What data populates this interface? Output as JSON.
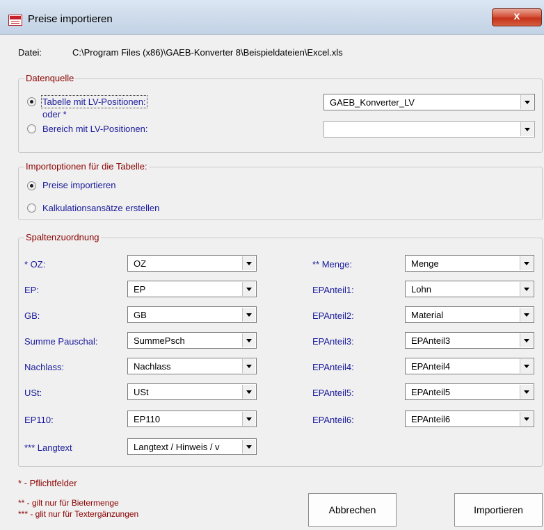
{
  "window": {
    "title": "Preise importieren",
    "close_glyph": "x"
  },
  "file": {
    "label": "Datei:",
    "path": "C:\\Program Files (x86)\\GAEB-Konverter 8\\Beispieldateien\\Excel.xls"
  },
  "datenquelle": {
    "title": "Datenquelle",
    "option_table": "Tabelle mit LV-Positionen:",
    "oder": "oder *",
    "option_range": "Bereich mit LV-Positionen:",
    "table_value": "GAEB_Konverter_LV",
    "range_value": ""
  },
  "importoptionen": {
    "title": "Importoptionen für die Tabelle:",
    "option_prices": "Preise importieren",
    "option_calc": "Kalkulationsansätze erstellen"
  },
  "spalten": {
    "title": "Spaltenzuordnung",
    "left": [
      {
        "label": "* OZ:",
        "value": "OZ"
      },
      {
        "label": "EP:",
        "value": "EP"
      },
      {
        "label": "GB:",
        "value": "GB"
      },
      {
        "label": "Summe Pauschal:",
        "value": "SummePsch"
      },
      {
        "label": "Nachlass:",
        "value": "Nachlass"
      },
      {
        "label": "USt:",
        "value": "USt"
      },
      {
        "label": "EP110:",
        "value": "EP110"
      },
      {
        "label": "*** Langtext",
        "value": "Langtext / Hinweis / v"
      }
    ],
    "right": [
      {
        "label": "** Menge:",
        "value": "Menge"
      },
      {
        "label": "EPAnteil1:",
        "value": "Lohn"
      },
      {
        "label": "EPAnteil2:",
        "value": "Material"
      },
      {
        "label": "EPAnteil3:",
        "value": "EPAnteil3"
      },
      {
        "label": "EPAnteil4:",
        "value": "EPAnteil4"
      },
      {
        "label": "EPAnteil5:",
        "value": "EPAnteil5"
      },
      {
        "label": "EPAnteil6:",
        "value": "EPAnteil6"
      }
    ]
  },
  "notes": {
    "pflicht": "* - Pflichtfelder",
    "bieter": "** - gilt nur für Bietermenge",
    "text": "*** - glit nur für Textergänzungen"
  },
  "buttons": {
    "cancel": "Abbrechen",
    "import": "Importieren"
  }
}
